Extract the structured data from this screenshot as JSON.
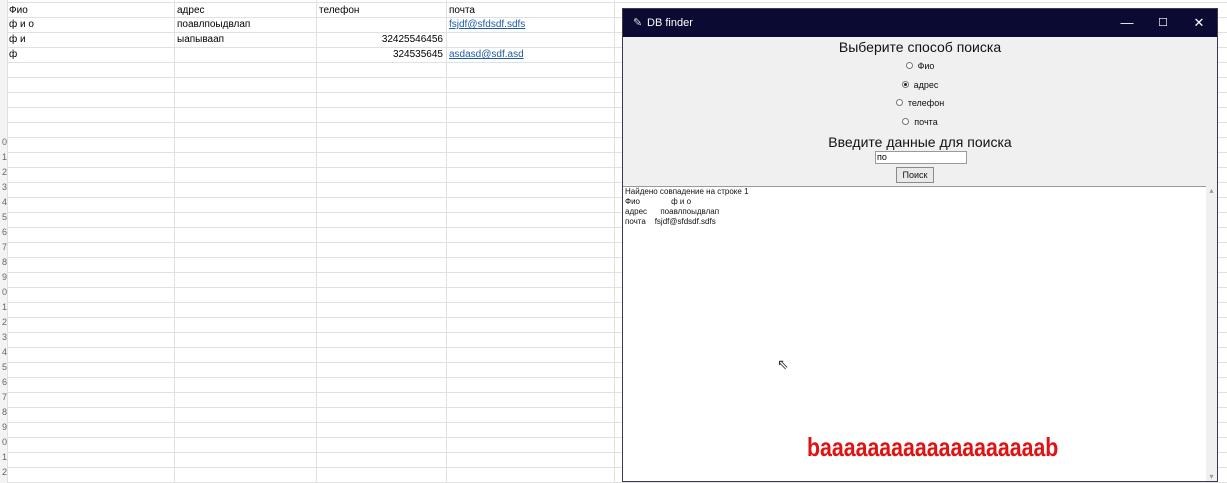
{
  "spreadsheet": {
    "headers": [
      "Фио",
      "адрес",
      "телефон",
      "почта"
    ],
    "rows": [
      {
        "fio": "ф и о",
        "address": "поавлпоыдвлап",
        "phone": "",
        "email": "fsjdf@sfdsdf.sdfs"
      },
      {
        "fio": "ф и",
        "address": "ыапываап",
        "phone": "32425546456",
        "email": ""
      },
      {
        "fio": "ф",
        "address": "",
        "phone": "324535645",
        "email": "asdasd@sdf.asd"
      }
    ],
    "row_numbers": [
      "",
      "",
      "",
      "",
      "",
      "",
      "",
      "",
      "",
      "0",
      "1",
      "2",
      "3",
      "4",
      "5",
      "6",
      "7",
      "8",
      "9",
      "0",
      "1",
      "2",
      "3",
      "4",
      "5",
      "6",
      "7",
      "8",
      "9",
      "0",
      "1",
      "2"
    ]
  },
  "window": {
    "title": "DB finder",
    "controls": {
      "minimize": "—",
      "maximize": "☐",
      "close": "✕"
    },
    "heading_method": "Выберите способ поиска",
    "options": [
      {
        "label": "Фио",
        "selected": false
      },
      {
        "label": "адрес",
        "selected": true
      },
      {
        "label": "телефон",
        "selected": false
      },
      {
        "label": "почта",
        "selected": false
      }
    ],
    "heading_input": "Введите данные для поиска",
    "search_value": "по",
    "search_button": "Поиск",
    "results": [
      "Найдено совпадение на строке 1",
      "Фио              ф и о",
      "адрес      поавлпоыдвлап",
      "почта    fsjdf@sfdsdf.sdfs"
    ]
  },
  "overlay_text": "baaaaaaaaaaaaaaaaaaab"
}
